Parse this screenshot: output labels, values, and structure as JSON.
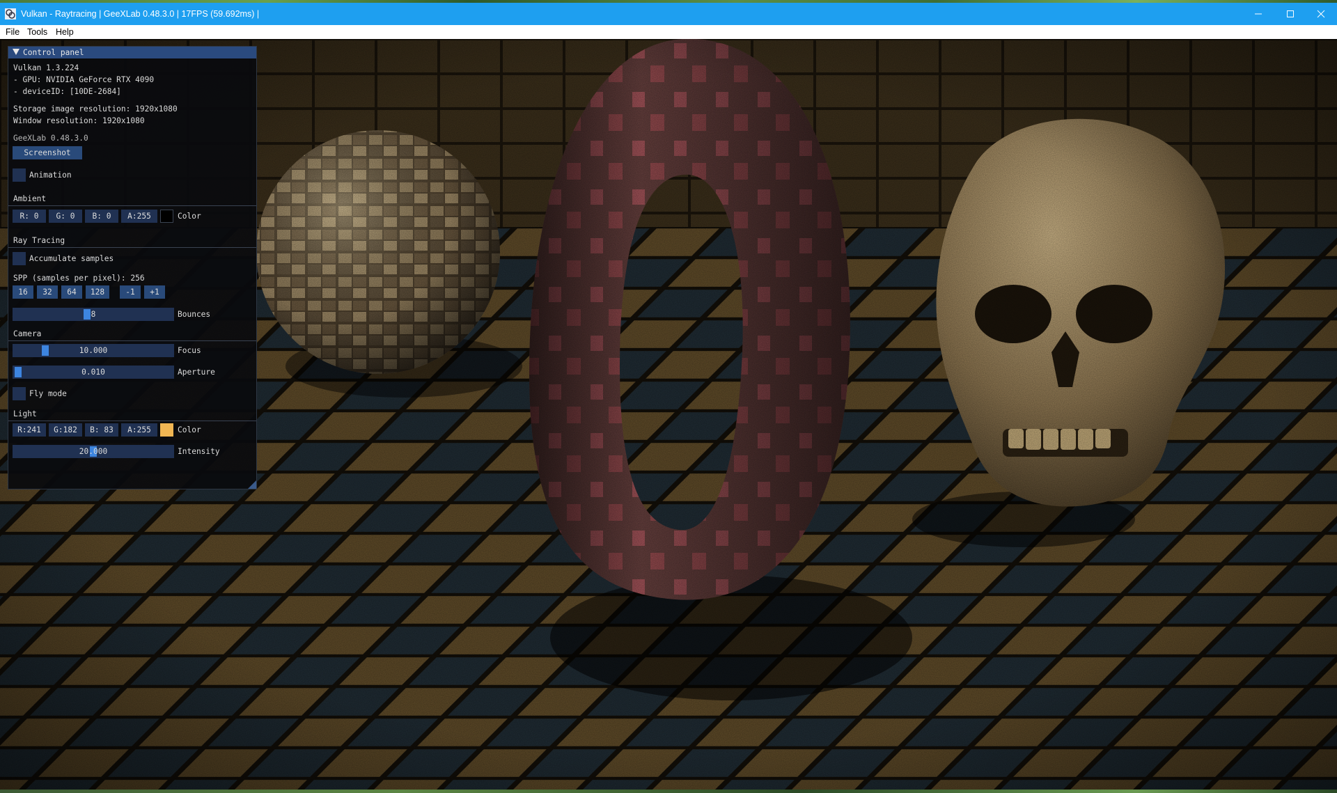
{
  "window": {
    "title": "Vulkan - Raytracing | GeeXLab 0.48.3.0 | 17FPS (59.692ms) |",
    "icons": {
      "app": "geexlab-icon",
      "minimize": "minimize-icon",
      "maximize": "maximize-icon",
      "close": "close-icon"
    }
  },
  "menu": {
    "items": [
      "File",
      "Tools",
      "Help"
    ]
  },
  "scene": {
    "objects": [
      "textured-sphere",
      "checkered-torus",
      "skull",
      "tiled-floor",
      "tiled-wall"
    ],
    "colors": {
      "tile_light": "#5e4a28",
      "tile_dark": "#1f2b33",
      "grout": "#120e08",
      "torus": "#6a4240",
      "skull": "#9a8358"
    }
  },
  "panel": {
    "title": "Control panel",
    "info": {
      "vulkan": "Vulkan 1.3.224",
      "gpu": "- GPU: NVIDIA GeForce RTX 4090",
      "device": "- deviceID: [10DE-2684]",
      "storage_res": "Storage image resolution: 1920x1080",
      "window_res": "Window resolution: 1920x1080",
      "geexlab": "GeeXLab 0.48.3.0"
    },
    "screenshot_button": "Screenshot",
    "animation": {
      "label": "Animation",
      "checked": false
    },
    "ambient": {
      "header": "Ambient",
      "r": "R:  0",
      "g": "G:  0",
      "b": "B:  0",
      "a": "A:255",
      "color_label": "Color",
      "swatch": "#000000"
    },
    "raytracing": {
      "header": "Ray Tracing",
      "accumulate": {
        "label": "Accumulate samples",
        "checked": false
      },
      "spp_label": "SPP (samples per pixel): 256",
      "spp_buttons": [
        "16",
        "32",
        "64",
        "128",
        "-1",
        "+1"
      ],
      "bounces": {
        "value": "8",
        "label": "Bounces",
        "fraction": 0.47
      }
    },
    "camera": {
      "header": "Camera",
      "focus": {
        "value": "10.000",
        "label": "Focus",
        "fraction": 0.2
      },
      "aperture": {
        "value": "0.010",
        "label": "Aperture",
        "fraction": 0.01
      },
      "fly_mode": {
        "label": "Fly mode",
        "checked": false
      }
    },
    "light": {
      "header": "Light",
      "r": "R:241",
      "g": "G:182",
      "b": "B: 83",
      "a": "A:255",
      "color_label": "Color",
      "swatch": "#f1b653",
      "intensity": {
        "value": "20.000",
        "label": "Intensity",
        "fraction": 0.5
      }
    },
    "colors": {
      "title_bg": "#2a4a7e",
      "frame_bg": "#203152",
      "button_bg": "#294a7a",
      "grab": "#3d85e0"
    }
  }
}
